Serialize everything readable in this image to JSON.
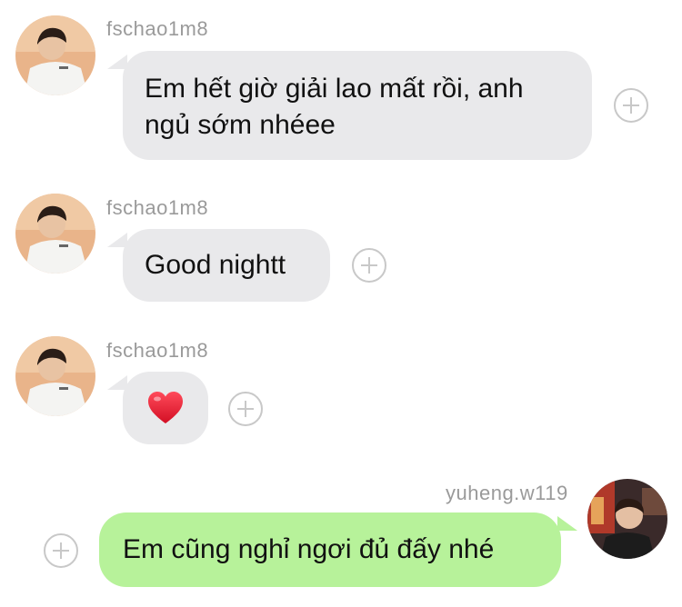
{
  "messages": [
    {
      "sender": "fschao1m8",
      "text": "Em hết giờ giải lao mất rồi, anh ngủ sớm nhéee",
      "direction": "incoming"
    },
    {
      "sender": "fschao1m8",
      "text": "Good nightt",
      "direction": "incoming"
    },
    {
      "sender": "fschao1m8",
      "text": "",
      "emoji": "heart",
      "direction": "incoming"
    },
    {
      "sender": "yuheng.w119",
      "text": "Em cũng nghỉ ngơi đủ đấy nhé",
      "direction": "outgoing"
    }
  ],
  "icons": {
    "reaction": "add-reaction-icon",
    "emoji": "red-heart-icon"
  },
  "colors": {
    "incoming_bubble": "#e9e9eb",
    "outgoing_bubble": "#b7f29a",
    "sender_text": "#9a9a9a",
    "plus_stroke": "#c8c8c8",
    "heart": "#e0142b"
  }
}
